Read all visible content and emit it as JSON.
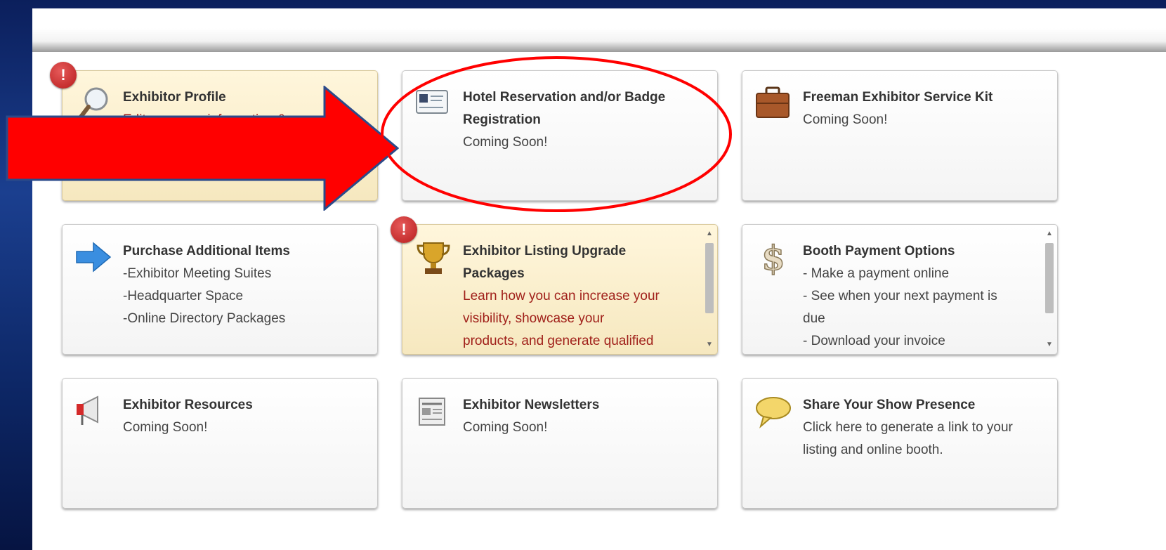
{
  "colors": {
    "slide_background": "#0b1f5c",
    "accent_red": "#ff0000",
    "warning_badge": "#c62828",
    "warning_tile": "#f6e8bf",
    "red_text": "#a0201a"
  },
  "tiles": [
    {
      "title": "Exhibitor Profile",
      "lines": [
        "Edit company information & s..."
      ],
      "icon": "magnifier-icon",
      "alert": "!"
    },
    {
      "title_line1": "Hotel Reservation and/or Badge",
      "title_line2": "Registration",
      "lines": [
        "Coming Soon!"
      ],
      "icon": "badge-card-icon"
    },
    {
      "title": "Freeman Exhibitor Service Kit",
      "lines": [
        "Coming Soon!"
      ],
      "icon": "briefcase-icon"
    },
    {
      "title": "Purchase Additional Items",
      "lines": [
        "-Exhibitor Meeting Suites",
        "-Headquarter Space",
        "-Online Directory Packages"
      ],
      "icon": "right-arrow-icon"
    },
    {
      "title_line1": "Exhibitor Listing Upgrade",
      "title_line2": "Packages",
      "lines": [
        "Learn how you can increase your",
        "visibility, showcase your",
        "products, and generate qualified"
      ],
      "icon": "trophy-icon",
      "alert": "!"
    },
    {
      "title": "Booth Payment Options",
      "lines": [
        "- Make a payment online",
        "- See when your next payment is",
        "due",
        "- Download your invoice"
      ],
      "icon": "dollar-sign-icon"
    },
    {
      "title": "Exhibitor Resources",
      "lines": [
        "Coming Soon!"
      ],
      "icon": "megaphone-icon"
    },
    {
      "title": "Exhibitor Newsletters",
      "lines": [
        "Coming Soon!"
      ],
      "icon": "newspaper-icon"
    },
    {
      "title": "Share Your Show Presence",
      "lines": [
        "Click here to generate a link to your",
        "listing and online booth."
      ],
      "icon": "speech-bubble-icon"
    }
  ]
}
